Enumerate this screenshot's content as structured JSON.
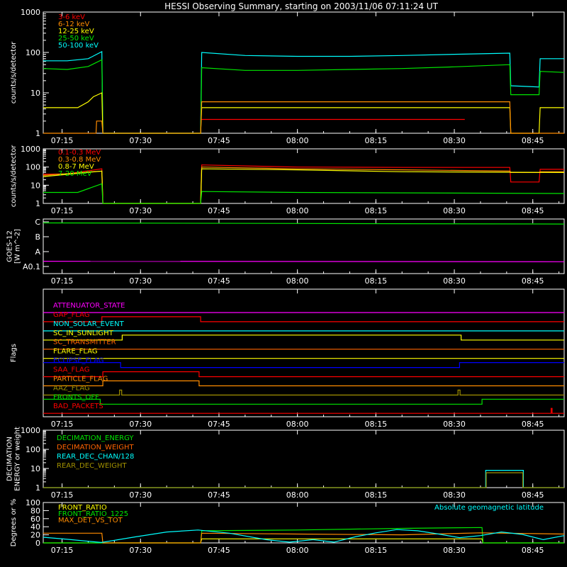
{
  "title": "HESSI Observing Summary, starting on 2003/11/06 07:11:24 UT",
  "colors": {
    "red": "#ff0000",
    "orange": "#ff8c00",
    "yellow": "#ffff00",
    "green": "#00e600",
    "cyan": "#00ffff",
    "magenta": "#ff00ff",
    "blue": "#0000ff",
    "olive": "#a09000",
    "orange2": "#ff6400",
    "white": "#ffffff"
  },
  "time_axis": {
    "start_minutes": 431.4,
    "end_minutes": 531.0,
    "tick_minutes": [
      435,
      450,
      465,
      480,
      495,
      510,
      525
    ],
    "tick_labels": [
      "07:15",
      "07:30",
      "07:45",
      "08:00",
      "08:15",
      "08:30",
      "08:45"
    ]
  },
  "chart_data": [
    {
      "type": "line",
      "name": "count-rates-low",
      "ylabel": "counts/s/detector",
      "yscale": "log",
      "ylim": [
        1,
        1000
      ],
      "yticks": [
        1,
        10,
        100,
        1000
      ],
      "ytick_labels": [
        "1",
        "10",
        "100",
        "1000"
      ],
      "legend": [
        "3-6 keV",
        "6-12 keV",
        "12-25 keV",
        "25-50 keV",
        "50-100 keV"
      ],
      "legend_colors": [
        "red",
        "orange",
        "yellow",
        "green",
        "cyan"
      ],
      "series": [
        {
          "name": "50-100 keV",
          "color": "cyan",
          "x": [
            431.4,
            436,
            440,
            442.6,
            442.8,
            461.5,
            461.7,
            470,
            480,
            490,
            500,
            510,
            520.6,
            520.8,
            526.2,
            526.4,
            531
          ],
          "y": [
            62,
            62,
            70,
            105,
            1,
            1,
            100,
            84,
            80,
            80,
            84,
            90,
            96,
            15,
            14,
            70,
            70
          ]
        },
        {
          "name": "25-50 keV",
          "color": "green",
          "x": [
            431.4,
            436,
            440,
            442.6,
            442.8,
            461.5,
            461.7,
            470,
            480,
            490,
            500,
            510,
            520.6,
            520.8,
            526.2,
            526.4,
            531
          ],
          "y": [
            40,
            38,
            45,
            66,
            1,
            1,
            42,
            36,
            36,
            38,
            40,
            44,
            50,
            9,
            9,
            34,
            32
          ]
        },
        {
          "name": "12-25 keV",
          "color": "yellow",
          "x": [
            431.4,
            438,
            440,
            441,
            442.6,
            442.8,
            461.5,
            461.7,
            480,
            500,
            511,
            520.6,
            520.8,
            526.2,
            526.4,
            531
          ],
          "y": [
            4.3,
            4.3,
            6,
            8,
            10,
            1,
            1,
            4.3,
            4.3,
            4.3,
            4.3,
            4.3,
            1,
            1,
            4.3,
            4.3
          ]
        },
        {
          "name": "6-12 keV",
          "color": "orange",
          "x": [
            431.4,
            441.5,
            441.6,
            442.6,
            442.8,
            461.5,
            461.7,
            500,
            511,
            520.6,
            520.8,
            531
          ],
          "y": [
            1,
            1,
            2,
            2,
            1,
            1,
            6,
            6,
            6,
            6,
            1,
            1
          ]
        },
        {
          "name": "3-6 keV",
          "color": "red",
          "x": [
            461.7,
            512
          ],
          "y": [
            2.2,
            2.2
          ]
        }
      ]
    },
    {
      "type": "line",
      "name": "count-rates-high",
      "ylabel": "counts/s/detector",
      "yscale": "log",
      "ylim": [
        1,
        1000
      ],
      "yticks": [
        1,
        10,
        100,
        1000
      ],
      "ytick_labels": [
        "1",
        "10",
        "100",
        "1000"
      ],
      "legend": [
        "0.1-0.3 MeV",
        "0.3-0.8 MeV",
        "0.8-7 MeV",
        "7-20 MeV"
      ],
      "legend_colors": [
        "red",
        "orange",
        "yellow",
        "green"
      ],
      "series": [
        {
          "name": "0.1-0.3 MeV",
          "color": "red",
          "x": [
            431.4,
            436,
            442.6,
            442.8,
            461.5,
            461.7,
            480,
            500,
            520.6,
            520.8,
            526.2,
            526.4,
            531
          ],
          "y": [
            40,
            42,
            80,
            1,
            1,
            130,
            100,
            95,
            95,
            15,
            15,
            75,
            75
          ]
        },
        {
          "name": "0.3-0.8 MeV",
          "color": "orange",
          "x": [
            431.4,
            442.6,
            442.8,
            461.5,
            461.7,
            480,
            500,
            520.6,
            520.8,
            526.2,
            526.4,
            531
          ],
          "y": [
            35,
            60,
            1,
            1,
            100,
            80,
            70,
            60,
            50,
            50,
            55,
            55
          ]
        },
        {
          "name": "0.8-7 MeV",
          "color": "yellow",
          "x": [
            431.4,
            442.6,
            442.8,
            461.5,
            461.7,
            480,
            500,
            531
          ],
          "y": [
            30,
            60,
            1,
            1,
            80,
            70,
            55,
            50
          ]
        },
        {
          "name": "7-20 MeV",
          "color": "green",
          "x": [
            431.4,
            438,
            442.6,
            442.8,
            461.5,
            461.7,
            480,
            500,
            531
          ],
          "y": [
            4,
            4,
            12,
            1,
            1,
            4.5,
            4,
            3.8,
            3.5
          ]
        }
      ]
    },
    {
      "type": "line",
      "name": "goes-flux",
      "ylabel": "GOES-12",
      "ylabel2": "[W m^-2]",
      "ytick_labels": [
        "A0.1",
        "A",
        "B",
        "C"
      ],
      "series": [
        {
          "name": "GOES high",
          "color": "green",
          "x": [
            431.4,
            531
          ],
          "y": [
            2.93,
            2.85
          ]
        },
        {
          "name": "GOES low",
          "color": "magenta",
          "x": [
            431.4,
            531
          ],
          "y": [
            0.35,
            0.32
          ]
        }
      ]
    },
    {
      "type": "line",
      "name": "flags",
      "ylabel": "Flags",
      "flags": [
        {
          "label": "ATTENUATOR_STATE",
          "color": "magenta",
          "x": [
            431.4,
            531
          ],
          "y": [
            0,
            0
          ]
        },
        {
          "label": "GAP_FLAG",
          "color": "red",
          "x": [
            431.4,
            442.6,
            442.6,
            461.5,
            461.5,
            531
          ],
          "y": [
            0,
            0,
            1,
            1,
            0,
            0
          ]
        },
        {
          "label": "NON_SOLAR_EVENT",
          "color": "cyan",
          "x": [
            431.4,
            531
          ],
          "y": [
            0,
            0
          ]
        },
        {
          "label": "SC_IN_SUNLIGHT",
          "color": "yellow",
          "x": [
            431.4,
            446.5,
            446.5,
            511.3,
            511.3,
            531
          ],
          "y": [
            0,
            0,
            1,
            1,
            0,
            0
          ]
        },
        {
          "label": "SC_TRANSMITTER",
          "color": "orange2",
          "x": [
            431.4,
            531
          ],
          "y": [
            0,
            0
          ]
        },
        {
          "label": "FLARE_FLAG",
          "color": "yellow",
          "x": [
            431.4,
            531
          ],
          "y": [
            0,
            0
          ]
        },
        {
          "label": "ECLIPSE_FLAG",
          "color": "blue",
          "x": [
            431.4,
            446.2,
            446.2,
            511.0,
            511.0,
            531
          ],
          "y": [
            1,
            1,
            0,
            0,
            1,
            1
          ]
        },
        {
          "label": "SAA_FLAG",
          "color": "red",
          "x": [
            431.4,
            442.8,
            442.8,
            461.2,
            461.2,
            531
          ],
          "y": [
            0,
            0,
            1,
            1,
            0,
            0
          ]
        },
        {
          "label": "PARTICLE_FLAG",
          "color": "orange",
          "x": [
            431.4,
            442.8,
            442.8,
            461.2,
            461.2,
            531
          ],
          "y": [
            0,
            0,
            1,
            1,
            0,
            0
          ]
        },
        {
          "label": "AAZ_FLAG",
          "color": "olive",
          "x": [
            431.4,
            446.0,
            446.0,
            446.4,
            446.4,
            510.7,
            510.7,
            511.1,
            511.1,
            531
          ],
          "y": [
            0,
            0,
            1,
            1,
            0,
            0,
            1,
            1,
            0,
            0
          ]
        },
        {
          "label": "FRONTS_OFF",
          "color": "green",
          "x": [
            431.4,
            442.3,
            442.3,
            515.3,
            515.3,
            531
          ],
          "y": [
            1,
            1,
            0,
            0,
            1,
            1
          ]
        },
        {
          "label": "BAD_PACKETS",
          "color": "red",
          "x": [
            431.4,
            528.5,
            528.5,
            528.7,
            528.7,
            531
          ],
          "y": [
            0,
            0,
            1,
            1,
            0,
            0
          ]
        }
      ]
    },
    {
      "type": "line",
      "name": "decimation",
      "ylabel": "DECIMATION",
      "ylabel2": "ENERGY or weight",
      "yscale": "log",
      "ylim": [
        1,
        1000
      ],
      "yticks": [
        1,
        10,
        100,
        1000
      ],
      "ytick_labels": [
        "1",
        "10",
        "100",
        "1000"
      ],
      "legend": [
        "DECIMATION_ENERGY",
        "DECIMATION_WEIGHT",
        "REAR_DEC_CHAN/128",
        "REAR_DEC_WEIGHT"
      ],
      "legend_colors": [
        "green",
        "orange2",
        "cyan",
        "olive"
      ],
      "series": [
        {
          "name": "REAR_DEC_CHAN/128",
          "color": "cyan",
          "x": [
            431.4,
            516.0,
            516.0,
            523.2,
            523.2,
            531
          ],
          "y": [
            1,
            1,
            8,
            8,
            1,
            1
          ]
        },
        {
          "name": "REAR_DEC_WEIGHT",
          "color": "olive",
          "x": [
            431.4,
            516.1,
            516.1,
            523.1,
            523.1,
            531
          ],
          "y": [
            1,
            1,
            6,
            6,
            1,
            1
          ]
        }
      ]
    },
    {
      "type": "line",
      "name": "ratios",
      "ylabel": "Degrees or %",
      "ylim": [
        0,
        100
      ],
      "yticks": [
        0,
        20,
        40,
        60,
        80,
        100
      ],
      "ytick_labels": [
        "0",
        "20",
        "40",
        "60",
        "80",
        "100"
      ],
      "legend": [
        "FRONT_RATIO",
        "FRONT_RATIO_1225",
        "MAX_DET_VS_TOT"
      ],
      "legend_colors": [
        "yellow",
        "green",
        "orange"
      ],
      "annotation": "Absolute geomagnetic latitude",
      "series": [
        {
          "name": "FRONT_RATIO",
          "color": "yellow",
          "x": [
            431.4,
            442.6,
            442.8,
            461.5,
            461.7,
            515.3,
            515.5,
            531
          ],
          "y": [
            0,
            0,
            0,
            0,
            10,
            10,
            0,
            0
          ]
        },
        {
          "name": "FRONT_RATIO_1225",
          "color": "green",
          "x": [
            431.4,
            442.6,
            442.8,
            461.5,
            461.7,
            480,
            500,
            515.3,
            515.5,
            531
          ],
          "y": [
            0,
            0,
            0,
            0,
            30,
            32,
            36,
            38,
            0,
            0
          ]
        },
        {
          "name": "MAX_DET_VS_TOT",
          "color": "orange",
          "x": [
            431.4,
            442.6,
            442.8,
            461.5,
            461.7,
            480,
            500,
            515,
            531
          ],
          "y": [
            24,
            24,
            0,
            0,
            24,
            22,
            20,
            25,
            22
          ]
        },
        {
          "name": "Absolute geomagnetic latitude",
          "color": "cyan",
          "x": [
            431.4,
            436,
            442.5,
            449,
            455,
            461,
            467,
            474,
            478.5,
            483,
            487,
            491,
            495,
            499,
            503,
            507,
            511,
            515,
            519,
            523,
            527,
            531
          ],
          "y": [
            14,
            9,
            1,
            15,
            27,
            32,
            24,
            8,
            2,
            8,
            2,
            15,
            25,
            33,
            30,
            22,
            13,
            18,
            27,
            21,
            8,
            18
          ]
        }
      ]
    }
  ]
}
